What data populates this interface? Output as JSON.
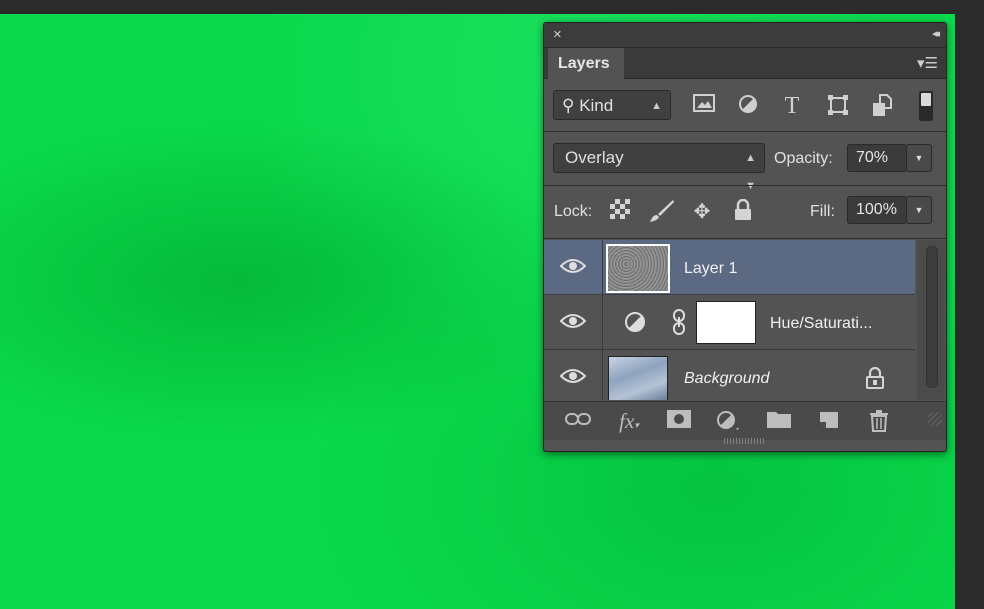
{
  "panel": {
    "close_icon": "×",
    "collapse_icon": "◂◂",
    "tab_label": "Layers",
    "menu_icon": "▾☰"
  },
  "filter": {
    "kind_label": "Kind",
    "icons": [
      "pixel-layer-filter-icon",
      "adjustment-layer-filter-icon",
      "type-layer-filter-icon",
      "shape-layer-filter-icon",
      "smart-object-filter-icon"
    ]
  },
  "blend": {
    "mode": "Overlay",
    "opacity_label": "Opacity:",
    "opacity_value": "70%",
    "lock_label": "Lock:",
    "fill_label": "Fill:",
    "fill_value": "100%"
  },
  "layers": [
    {
      "name": "Layer 1",
      "selected": true
    },
    {
      "name": "Hue/Saturati...",
      "selected": false
    },
    {
      "name": "Background",
      "selected": false,
      "locked": true
    }
  ],
  "bottom_icons": [
    "link-layers-icon",
    "fx-icon",
    "add-mask-icon",
    "new-adjustment-icon",
    "new-group-folder-icon",
    "new-layer-icon",
    "trash-icon"
  ],
  "colors": {
    "canvas": "#0ad94c",
    "panel_bg": "#535353",
    "selected_row": "#5c6982"
  }
}
